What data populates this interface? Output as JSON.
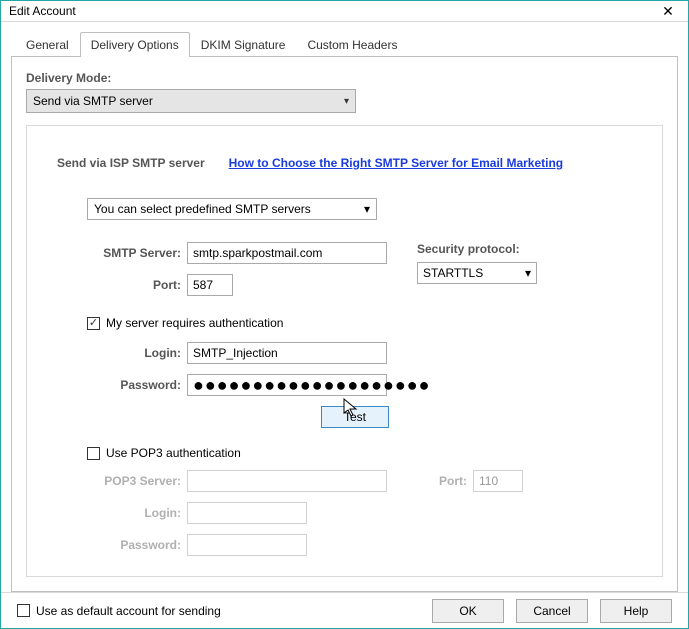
{
  "window": {
    "title": "Edit Account"
  },
  "tabs": {
    "general": "General",
    "delivery": "Delivery Options",
    "dkim": "DKIM Signature",
    "headers": "Custom Headers"
  },
  "deliveryMode": {
    "label": "Delivery Mode:",
    "selected": "Send via SMTP server"
  },
  "smtpFrame": {
    "heading": "Send via ISP SMTP server",
    "helpLink": "How to Choose the Right SMTP Server for Email Marketing",
    "predefined": "You can select predefined SMTP servers",
    "smtpServerLabel": "SMTP Server:",
    "smtpServerValue": "smtp.sparkpostmail.com",
    "portLabel": "Port:",
    "portValue": "587",
    "securityLabel": "Security protocol:",
    "securityValue": "STARTTLS",
    "authCheck": "My server requires authentication",
    "loginLabel": "Login:",
    "loginValue": "SMTP_Injection",
    "passwordLabel": "Password:",
    "passwordValue": "●●●●●●●●●●●●●●●●●●●●",
    "testBtn": "Test",
    "pop3Check": "Use POP3 authentication",
    "pop3ServerLabel": "POP3 Server:",
    "pop3ServerValue": "",
    "pop3PortLabel": "Port:",
    "pop3PortValue": "110",
    "pop3LoginLabel": "Login:",
    "pop3PasswordLabel": "Password:"
  },
  "bottom": {
    "defaultCheck": "Use as default account for sending",
    "ok": "OK",
    "cancel": "Cancel",
    "help": "Help"
  }
}
